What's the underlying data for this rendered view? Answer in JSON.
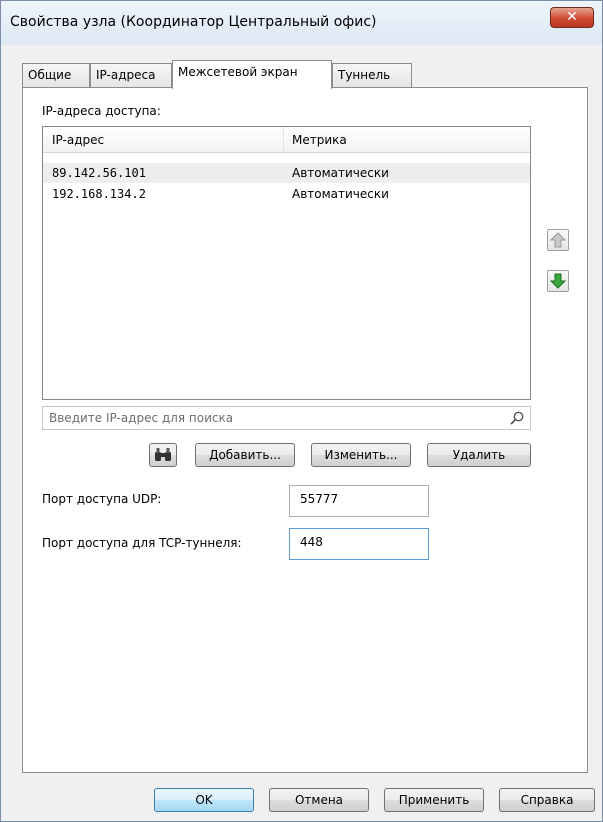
{
  "window": {
    "title": "Свойства узла (Координатор Центральный офис)",
    "close_glyph": "✕"
  },
  "tabs": [
    {
      "label": "Общие"
    },
    {
      "label": "IP-адреса"
    },
    {
      "label": "Межсетевой экран"
    },
    {
      "label": "Туннель"
    }
  ],
  "panel": {
    "access_label": "IP-адреса доступа:",
    "columns": {
      "ip": "IP-адрес",
      "metric": "Метрика"
    },
    "rows": [
      {
        "ip": "89.142.56.101",
        "metric": "Автоматически",
        "selected": true
      },
      {
        "ip": "192.168.134.2",
        "metric": "Автоматически",
        "selected": false
      }
    ],
    "search_placeholder": "Введите IP-адрес для поиска",
    "buttons": {
      "add": "Добавить...",
      "edit": "Изменить...",
      "delete": "Удалить"
    },
    "udp_label": "Порт доступа UDP:",
    "udp_value": "55777",
    "tcp_label": "Порт доступа для TCP-туннеля:",
    "tcp_value": "448"
  },
  "footer": {
    "ok": "OK",
    "cancel": "Отмена",
    "apply": "Применить",
    "help": "Справка"
  },
  "colors": {
    "accent": "#3c7fb1",
    "close": "#cf4a32",
    "arrow_green": "#2e9a2e",
    "arrow_gray": "#a8a8a8"
  }
}
